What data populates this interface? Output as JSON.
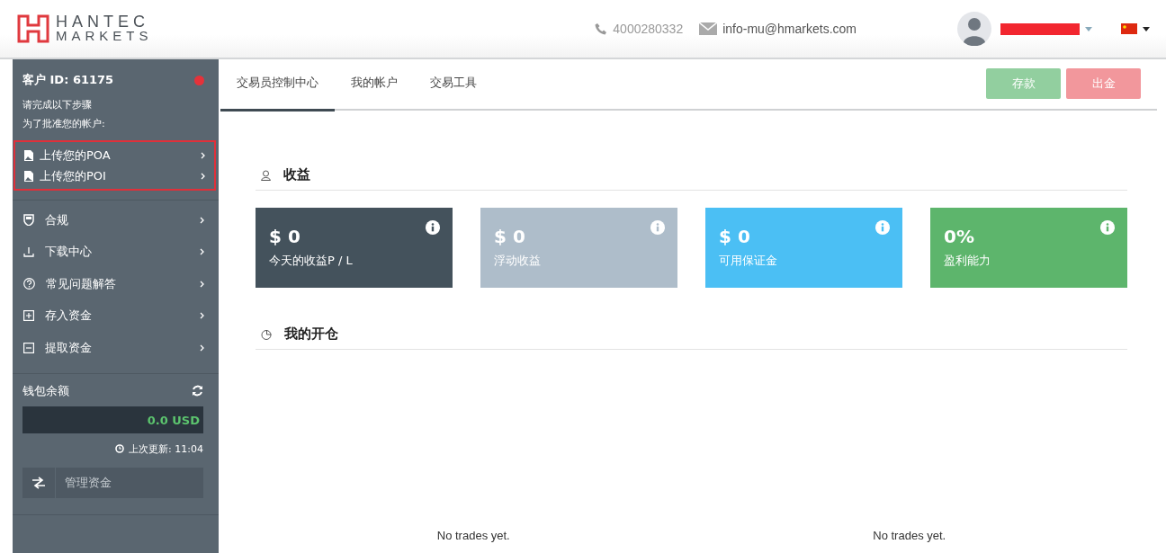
{
  "header": {
    "logo_top": "HANTEC",
    "logo_bottom": "MARKETS",
    "phone": "4000280332",
    "email": "info-mu@hmarkets.com"
  },
  "sidebar": {
    "client_id": "客户 ID: 61175",
    "steps_title": "请完成以下步骤",
    "steps_subtitle": "为了批准您的帐户:",
    "steps": [
      {
        "label": "上传您的POA"
      },
      {
        "label": "上传您的POI"
      }
    ],
    "items": [
      {
        "label": "合规"
      },
      {
        "label": "下载中心"
      },
      {
        "label": "常见问题解答"
      },
      {
        "label": "存入资金"
      },
      {
        "label": "提取资金"
      }
    ],
    "wallet": {
      "title": "钱包余额",
      "balance": "0.0 USD",
      "updated": "上次更新: 11:04",
      "manage": "管理资金"
    }
  },
  "tabs": [
    {
      "label": "交易员控制中心",
      "selected": true
    },
    {
      "label": "我的帐户",
      "selected": false
    },
    {
      "label": "交易工具",
      "selected": false
    }
  ],
  "actions": [
    {
      "label": "存款",
      "color": "#92cf9f"
    },
    {
      "label": "出金",
      "color": "#f2979c"
    }
  ],
  "earnings": {
    "title": "收益",
    "cards": [
      {
        "value": "$ 0",
        "label": "今天的收益P / L",
        "color": "#44525c"
      },
      {
        "value": "$ 0",
        "label": "浮动收益",
        "color": "#aebdca"
      },
      {
        "value": "$ 0",
        "label": "可用保证金",
        "color": "#4bbff4"
      },
      {
        "value": "0%",
        "label": "盈利能力",
        "color": "#5db56c"
      }
    ]
  },
  "positions": {
    "title": "我的开仓",
    "empty_messages": [
      "No trades yet.",
      "No trades yet."
    ]
  }
}
